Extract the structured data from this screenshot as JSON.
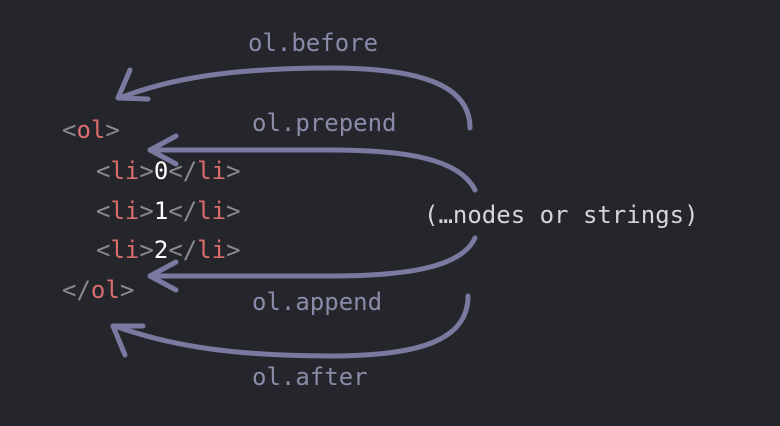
{
  "colors": {
    "background": "#25262b",
    "arrow": "#7a7aa0",
    "label": "#8b8aa8",
    "tag": "#d96c6c",
    "punct": "#8a8a93",
    "text": "#ffffff",
    "center_label": "#d4d4dc"
  },
  "code": {
    "ol_open": {
      "lt": "<",
      "tag": "ol",
      "gt": ">"
    },
    "items": [
      {
        "open_lt": "<",
        "open_tag": "li",
        "open_gt": ">",
        "text": "0",
        "close_lt": "</",
        "close_tag": "li",
        "close_gt": ">"
      },
      {
        "open_lt": "<",
        "open_tag": "li",
        "open_gt": ">",
        "text": "1",
        "close_lt": "</",
        "close_tag": "li",
        "close_gt": ">"
      },
      {
        "open_lt": "<",
        "open_tag": "li",
        "open_gt": ">",
        "text": "2",
        "close_lt": "</",
        "close_tag": "li",
        "close_gt": ">"
      }
    ],
    "ol_close": {
      "lt": "</",
      "tag": "ol",
      "gt": ">"
    }
  },
  "labels": {
    "before": "ol.before",
    "prepend": "ol.prepend",
    "append": "ol.append",
    "after": "ol.after",
    "args": "(…nodes or strings)"
  }
}
